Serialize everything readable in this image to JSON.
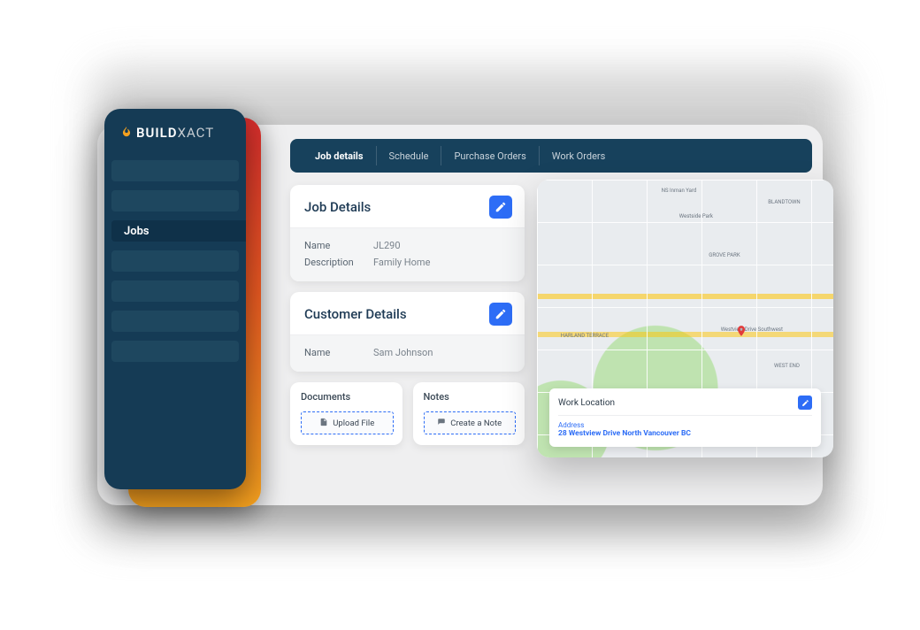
{
  "brand": {
    "name_bold": "BUILD",
    "name_light": "XACT"
  },
  "sidebar": {
    "items": [
      {
        "label": ""
      },
      {
        "label": ""
      },
      {
        "label": "Jobs",
        "active": true
      },
      {
        "label": ""
      },
      {
        "label": ""
      },
      {
        "label": ""
      },
      {
        "label": ""
      }
    ]
  },
  "tabs": [
    {
      "label": "Job details",
      "active": true
    },
    {
      "label": "Schedule"
    },
    {
      "label": "Purchase Orders"
    },
    {
      "label": "Work Orders"
    }
  ],
  "job_details": {
    "title": "Job Details",
    "name_label": "Name",
    "name_value": "JL290",
    "description_label": "Description",
    "description_value": "Family Home"
  },
  "customer_details": {
    "title": "Customer Details",
    "name_label": "Name",
    "name_value": "Sam Johnson"
  },
  "documents": {
    "title": "Documents",
    "upload_label": "Upload File"
  },
  "notes": {
    "title": "Notes",
    "create_label": "Create a Note"
  },
  "work_location": {
    "title": "Work Location",
    "address_label": "Address",
    "address_value": "28 Westview Drive North Vancouver BC"
  },
  "map_labels": {
    "a": "NS Inman Yard",
    "b": "BLANDTOWN",
    "c": "Westside Park",
    "d": "GROVE PARK",
    "e": "HARLAND TERRACE",
    "f": "WEST END",
    "g": "Westview Drive Southwest"
  }
}
